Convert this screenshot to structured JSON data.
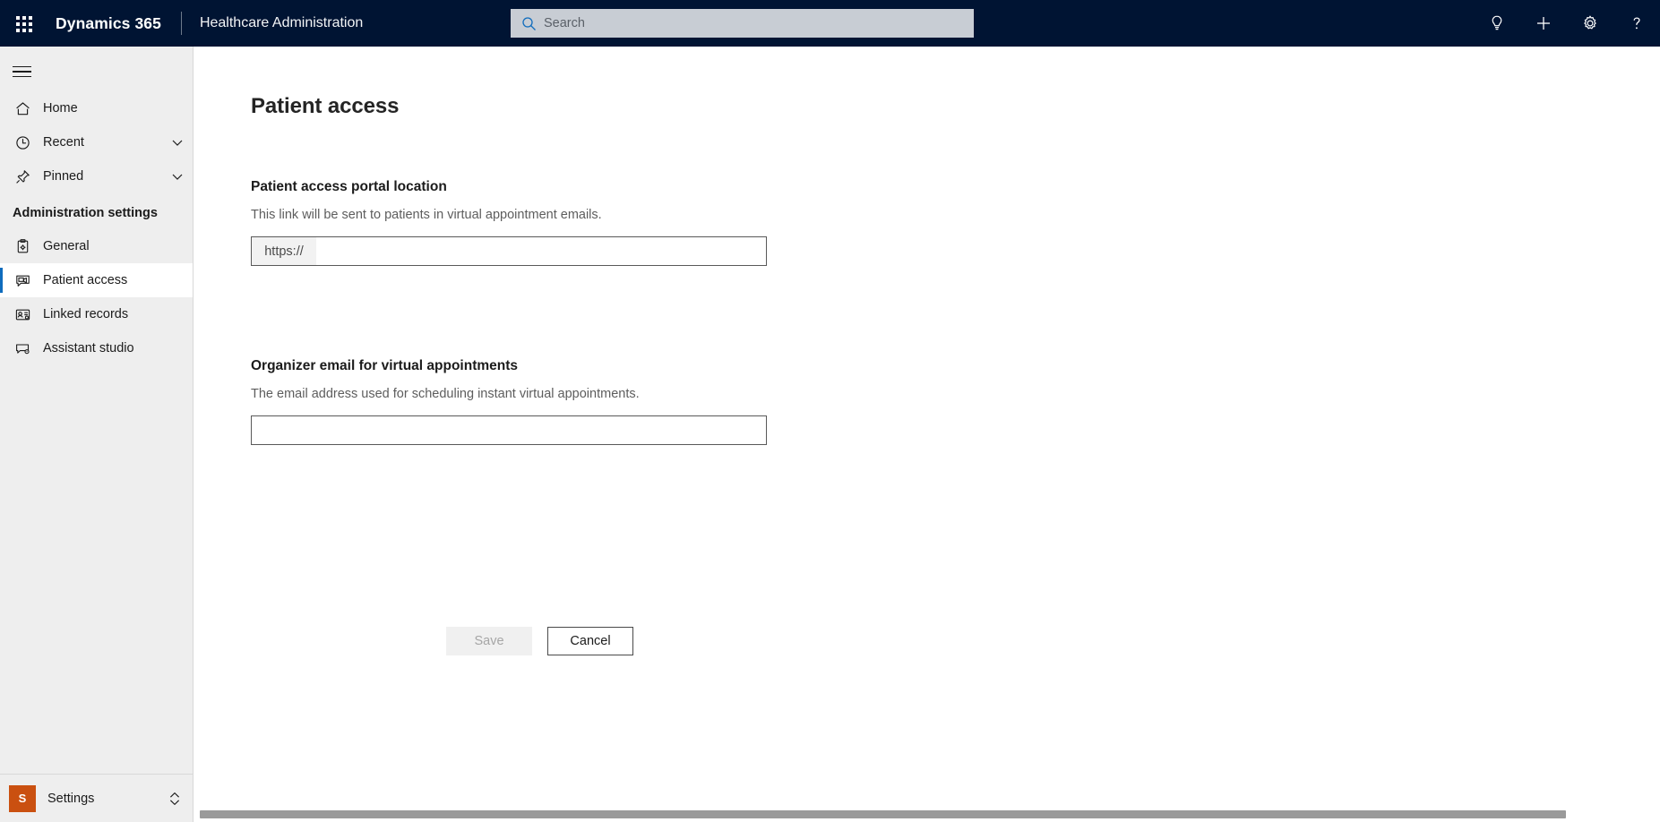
{
  "header": {
    "waffle_icon": "waffle-grid-icon",
    "brand": "Dynamics 365",
    "app_name": "Healthcare Administration",
    "search": {
      "placeholder": "Search",
      "value": "",
      "icon": "search-icon"
    },
    "actions": [
      {
        "name": "lightbulb-icon",
        "label": "Insights"
      },
      {
        "name": "plus-icon",
        "label": "New"
      },
      {
        "name": "gear-icon",
        "label": "Settings"
      },
      {
        "name": "question-mark-icon",
        "label": "Help"
      }
    ]
  },
  "sidebar": {
    "collapse_icon": "hamburger-icon",
    "nav_items": [
      {
        "label": "Home",
        "icon": "home-icon",
        "chevron": false,
        "selected": false
      },
      {
        "label": "Recent",
        "icon": "clock-icon",
        "chevron": true,
        "selected": false
      },
      {
        "label": "Pinned",
        "icon": "pin-icon",
        "chevron": true,
        "selected": false
      }
    ],
    "group_title": "Administration settings",
    "group_items": [
      {
        "label": "General",
        "icon": "clipboard-gear-icon",
        "selected": false
      },
      {
        "label": "Patient access",
        "icon": "video-chat-icon",
        "selected": true
      },
      {
        "label": "Linked records",
        "icon": "contact-card-gear-icon",
        "selected": false
      },
      {
        "label": "Assistant studio",
        "icon": "assistant-gear-icon",
        "selected": false
      }
    ],
    "settings": {
      "avatar_initial": "S",
      "avatar_color": "#ca5010",
      "label": "Settings",
      "chevron_icon": "chevron-up-down-icon"
    }
  },
  "main": {
    "page_title": "Patient access",
    "sections": [
      {
        "heading": "Patient access portal location",
        "description": "This link will be sent to patients in virtual appointment emails.",
        "field": {
          "prefix": "https://",
          "value": "",
          "placeholder": ""
        }
      },
      {
        "heading": "Organizer email for virtual appointments",
        "description": "The email address used for scheduling instant virtual appointments.",
        "field": {
          "value": "",
          "placeholder": ""
        }
      }
    ],
    "buttons": {
      "save": "Save",
      "save_disabled": true,
      "cancel": "Cancel"
    }
  },
  "colors": {
    "header_background": "#001433",
    "accent": "#0f6cbd",
    "sidebar_background": "#eeeeee",
    "settings_avatar": "#ca5010",
    "search_background": "#c8cdd4"
  }
}
